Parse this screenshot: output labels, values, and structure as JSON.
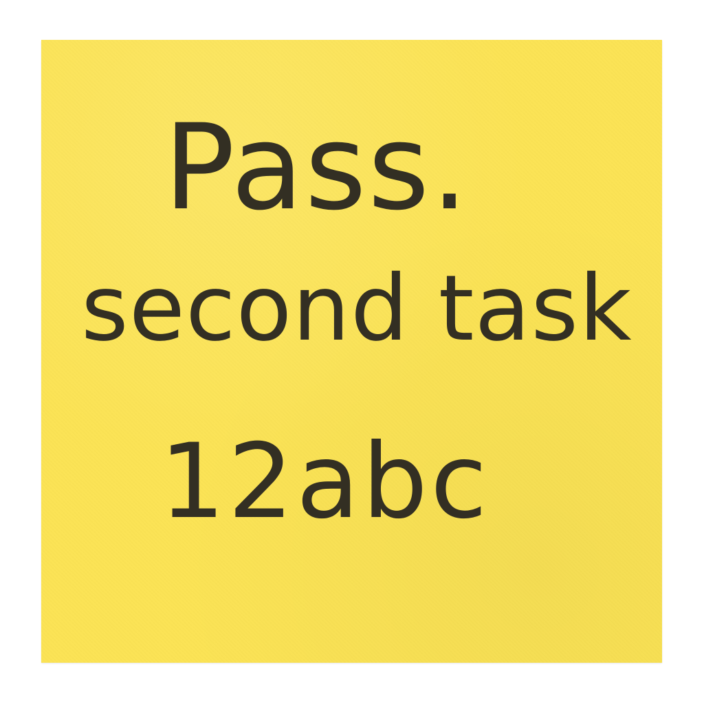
{
  "note": {
    "background_color": "#fbe355",
    "ink_color": "#332f23",
    "lines": [
      "Pass.",
      "second task",
      "12abc"
    ]
  }
}
